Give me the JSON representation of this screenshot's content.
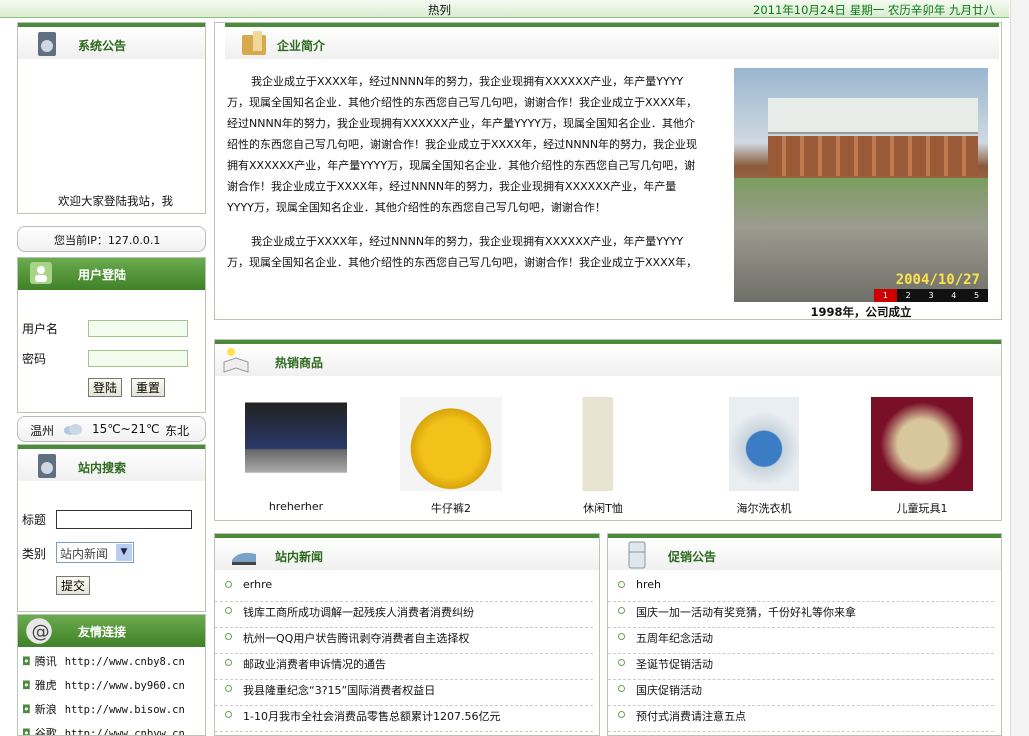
{
  "topbar": {
    "hot": "热列",
    "date": "2011年10月24日 星期一 农历辛卯年 九月廿八"
  },
  "announce": {
    "title": "系统公告",
    "text": "欢迎大家登陆我站，我"
  },
  "ip": {
    "text": "您当前IP：127.0.0.1"
  },
  "login": {
    "title": "用户登陆",
    "user_label": "用户名",
    "pass_label": "密码",
    "login_btn": "登陆",
    "reset_btn": "重置"
  },
  "weather": {
    "city": "温州",
    "temp": "15℃~21℃",
    "wind": "东北"
  },
  "search": {
    "title": "站内搜索",
    "title_label": "标题",
    "type_label": "类别",
    "type_value": "站内新闻",
    "submit": "提交"
  },
  "links": {
    "title": "友情连接",
    "items": [
      {
        "name": "腾讯",
        "url": "http://www.cnby8.cn"
      },
      {
        "name": "雅虎",
        "url": "http://www.by960.cn"
      },
      {
        "name": "新浪",
        "url": "http://www.bisow.cn"
      },
      {
        "name": "谷歌",
        "url": "http://www.cnbyw.cn"
      }
    ]
  },
  "intro": {
    "title": "企业简介",
    "p1": "我企业成立于XXXX年，经过NNNN年的努力，我企业现拥有XXXXXX产业，年产量YYYY万，现属全国知名企业．其他介绍性的东西您自己写几句吧，谢谢合作！我企业成立于XXXX年，经过NNNN年的努力，我企业现拥有XXXXXX产业，年产量YYYY万，现属全国知名企业．其他介绍性的东西您自己写几句吧，谢谢合作！我企业成立于XXXX年，经过NNNN年的努力，我企业现拥有XXXXXX产业，年产量YYYY万，现属全国知名企业．其他介绍性的东西您自己写几句吧，谢谢合作！我企业成立于XXXX年，经过NNNN年的努力，我企业现拥有XXXXXX产业，年产量YYYY万，现属全国知名企业．其他介绍性的东西您自己写几句吧，谢谢合作！",
    "p2": "我企业成立于XXXX年，经过NNNN年的努力，我企业现拥有XXXXXX产业，年产量YYYY万，现属全国知名企业．其他介绍性的东西您自己写几句吧，谢谢合作！我企业成立于XXXX年，",
    "photo_date": "2004/10/27",
    "caption": "1998年，公司成立",
    "pages": [
      "1",
      "2",
      "3",
      "4",
      "5"
    ]
  },
  "hot": {
    "title": "热销商品",
    "items": [
      "hreherher",
      "牛仔裤2",
      "休闲T恤",
      "海尔洗衣机",
      "儿童玩具1"
    ]
  },
  "news": {
    "title": "站内新闻",
    "items": [
      "erhre",
      "钱库工商所成功调解一起残疾人消费者消费纠纷",
      "杭州一QQ用户状告腾讯剥夺消费者自主选择权",
      "邮政业消费者申诉情况的通告",
      "我县隆重纪念“3?15”国际消费者权益日",
      "1-10月我市全社会消费品零售总额累计1207.56亿元"
    ]
  },
  "promo": {
    "title": "促销公告",
    "items": [
      "hreh",
      "国庆一加一活动有奖竞猜，千份好礼等你来拿",
      "五周年纪念活动",
      "圣诞节促销活动",
      "国庆促销活动",
      "预付式消费请注意五点"
    ]
  },
  "colors": {
    "green": "#4a8a3a",
    "date": "#0b7a14"
  }
}
